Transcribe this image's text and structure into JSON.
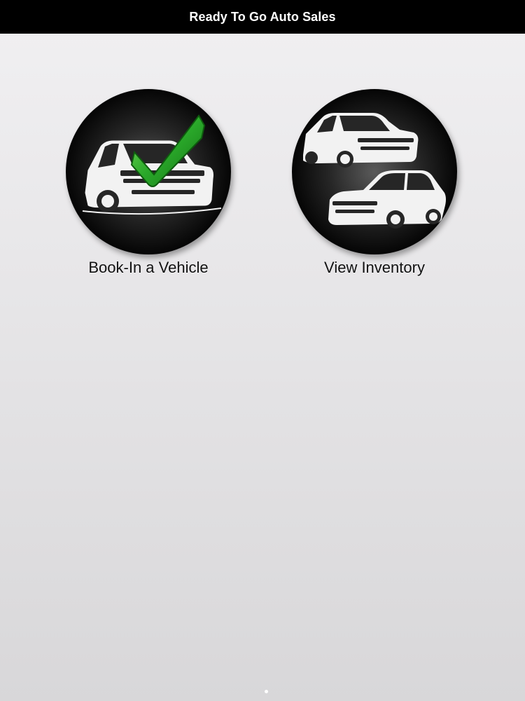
{
  "header": {
    "title": "Ready To Go Auto Sales"
  },
  "tiles": [
    {
      "label": "Book-In a Vehicle",
      "icon": "car-checkmark-icon"
    },
    {
      "label": "View Inventory",
      "icon": "two-cars-icon"
    }
  ],
  "pager": {
    "pages": 1,
    "current": 1
  },
  "colors": {
    "header_bg": "#000000",
    "header_text": "#ffffff",
    "check_green": "#2aa82a",
    "disc_dark": "#111111"
  }
}
